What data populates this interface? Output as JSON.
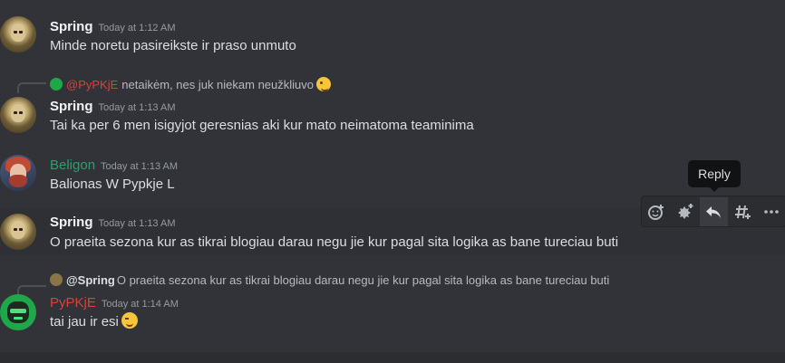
{
  "messages": [
    {
      "username": "Spring",
      "timestamp": "Today at 1:12 AM",
      "text": "Minde noretu pasireikste ir praso unmuto"
    },
    {
      "reply": {
        "mention": "@PyPKjE",
        "text": "netaikėm, nes juk niekam neužkliuvo"
      },
      "username": "Spring",
      "timestamp": "Today at 1:13 AM",
      "text": "Tai ka per 6 men isigyjot geresnias aki kur mato neimatoma teaminima"
    },
    {
      "username": "Beligon",
      "timestamp": "Today at 1:13 AM",
      "text": "Balionas W Pypkje L"
    },
    {
      "username": "Spring",
      "timestamp": "Today at 1:13 AM",
      "text": "O praeita sezona kur as tikrai blogiau darau negu jie kur pagal sita logika as bane tureciau buti"
    },
    {
      "reply": {
        "mention": "@Spring",
        "text": "O praeita sezona kur as tikrai blogiau darau negu jie kur pagal sita logika as bane tureciau buti"
      },
      "username": "PyPKjE",
      "timestamp": "Today at 1:14 AM",
      "text": "tai jau ir esi"
    }
  ],
  "tooltip": {
    "label": "Reply"
  },
  "toolbar": {
    "icons": [
      "add-reaction-icon",
      "super-reaction-icon",
      "reply-icon",
      "create-thread-icon",
      "more-icon"
    ]
  },
  "colors": {
    "background": "#313338",
    "username_spring": "#f2f3f5",
    "username_beligon": "#2f9e6d",
    "username_pypkje": "#d9413c"
  }
}
